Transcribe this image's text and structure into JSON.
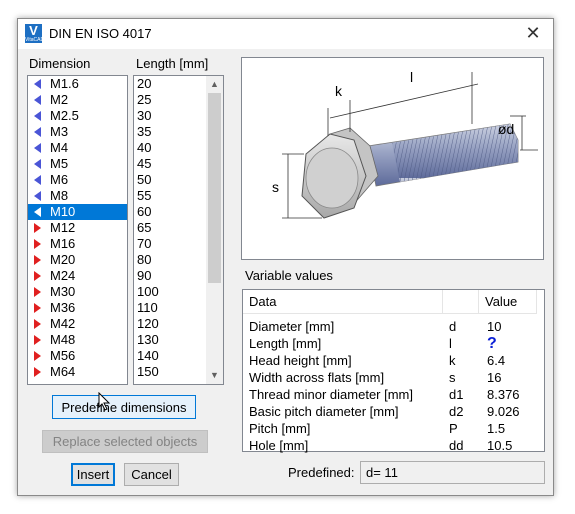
{
  "window": {
    "title": "DIN EN ISO 4017",
    "icon_text": "V",
    "icon_subtext": "VitaCAD",
    "close_glyph": "✕"
  },
  "dimension": {
    "label": "Dimension",
    "items": [
      {
        "label": "M1.6",
        "kind": "blue"
      },
      {
        "label": "M2",
        "kind": "blue"
      },
      {
        "label": "M2.5",
        "kind": "blue"
      },
      {
        "label": "M3",
        "kind": "blue"
      },
      {
        "label": "M4",
        "kind": "blue"
      },
      {
        "label": "M5",
        "kind": "blue"
      },
      {
        "label": "M6",
        "kind": "blue"
      },
      {
        "label": "M8",
        "kind": "blue"
      },
      {
        "label": "M10",
        "kind": "blue",
        "selected": true
      },
      {
        "label": "M12",
        "kind": "red"
      },
      {
        "label": "M16",
        "kind": "red"
      },
      {
        "label": "M20",
        "kind": "red"
      },
      {
        "label": "M24",
        "kind": "red"
      },
      {
        "label": "M30",
        "kind": "red"
      },
      {
        "label": "M36",
        "kind": "red"
      },
      {
        "label": "M42",
        "kind": "red"
      },
      {
        "label": "M48",
        "kind": "red"
      },
      {
        "label": "M56",
        "kind": "red"
      },
      {
        "label": "M64",
        "kind": "red"
      }
    ]
  },
  "length": {
    "label": "Length [mm]",
    "items": [
      "20",
      "25",
      "30",
      "35",
      "40",
      "45",
      "50",
      "55",
      "60",
      "65",
      "70",
      "80",
      "90",
      "100",
      "110",
      "120",
      "130",
      "140",
      "150"
    ]
  },
  "buttons": {
    "predefine": "Predefine dimensions",
    "replace": "Replace selected objects",
    "insert": "Insert",
    "cancel": "Cancel"
  },
  "drawing": {
    "k": "k",
    "l": "l",
    "d": "ød",
    "s": "s"
  },
  "variables": {
    "label": "Variable values",
    "headers": {
      "data": "Data",
      "symbol": "",
      "value": "Value"
    },
    "rows": [
      {
        "data": "Diameter [mm]",
        "symbol": "d",
        "value": "10"
      },
      {
        "data": "Length [mm]",
        "symbol": "l",
        "value": "?"
      },
      {
        "data": "Head height [mm]",
        "symbol": "k",
        "value": "6.4"
      },
      {
        "data": "Width across flats [mm]",
        "symbol": "s",
        "value": "16"
      },
      {
        "data": "Thread minor diameter [mm]",
        "symbol": "d1",
        "value": "8.376"
      },
      {
        "data": "Basic pitch diameter [mm]",
        "symbol": "d2",
        "value": "9.026"
      },
      {
        "data": "Pitch [mm]",
        "symbol": "P",
        "value": "1.5"
      },
      {
        "data": "Hole [mm]",
        "symbol": "dd",
        "value": "10.5"
      }
    ]
  },
  "predefined": {
    "label": "Predefined:",
    "value": "d= 11"
  }
}
